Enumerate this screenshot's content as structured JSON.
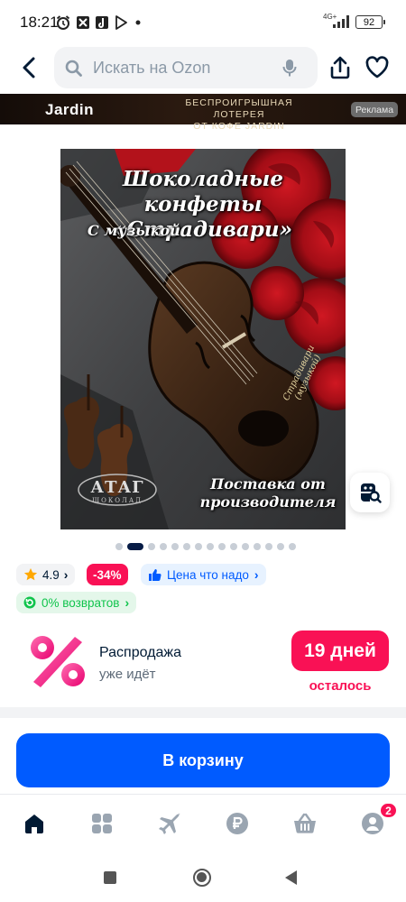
{
  "status_bar": {
    "time": "18:21",
    "network": "4G+",
    "battery": "92"
  },
  "header": {
    "search_placeholder": "Искать на Ozon"
  },
  "ad_banner": {
    "brand": "Jardin",
    "text_line1": "БЕСПРОИГРЫШНАЯ ЛОТЕРЕЯ",
    "text_line2": "ОТ КОФЕ JARDIN",
    "tag": "Реклама"
  },
  "product_image": {
    "title_line1": "Шоколадные конфеты",
    "title_line2": "«Страдивари»",
    "subtitle": "С музыкой",
    "footer_line1": "Поставка от",
    "footer_line2": "производителя",
    "logo_text": "АТАГ",
    "logo_sub": "ШОКОЛАД",
    "engraving_line1": "Страдивари",
    "engraving_line2": "(музыкой)",
    "gallery_count": 15,
    "gallery_active_index": 1
  },
  "chips": {
    "rating": "4.9",
    "discount": "-34%",
    "price_label": "Цена что надо",
    "returns_label": "0% возвратов"
  },
  "sale": {
    "title": "Распродажа",
    "subtitle": "уже идёт",
    "days": "19 дней",
    "days_suffix": "осталось"
  },
  "cart": {
    "button_label": "В корзину"
  },
  "bottom_nav": {
    "items": [
      "home-icon",
      "catalog-icon",
      "travel-icon",
      "ruble-icon",
      "cart-icon",
      "profile-icon"
    ],
    "profile_badge": "2"
  },
  "colors": {
    "brand_blue": "#005bff",
    "accent_pink": "#f91155",
    "positive_green": "#10c44c",
    "text_primary": "#001a34"
  }
}
